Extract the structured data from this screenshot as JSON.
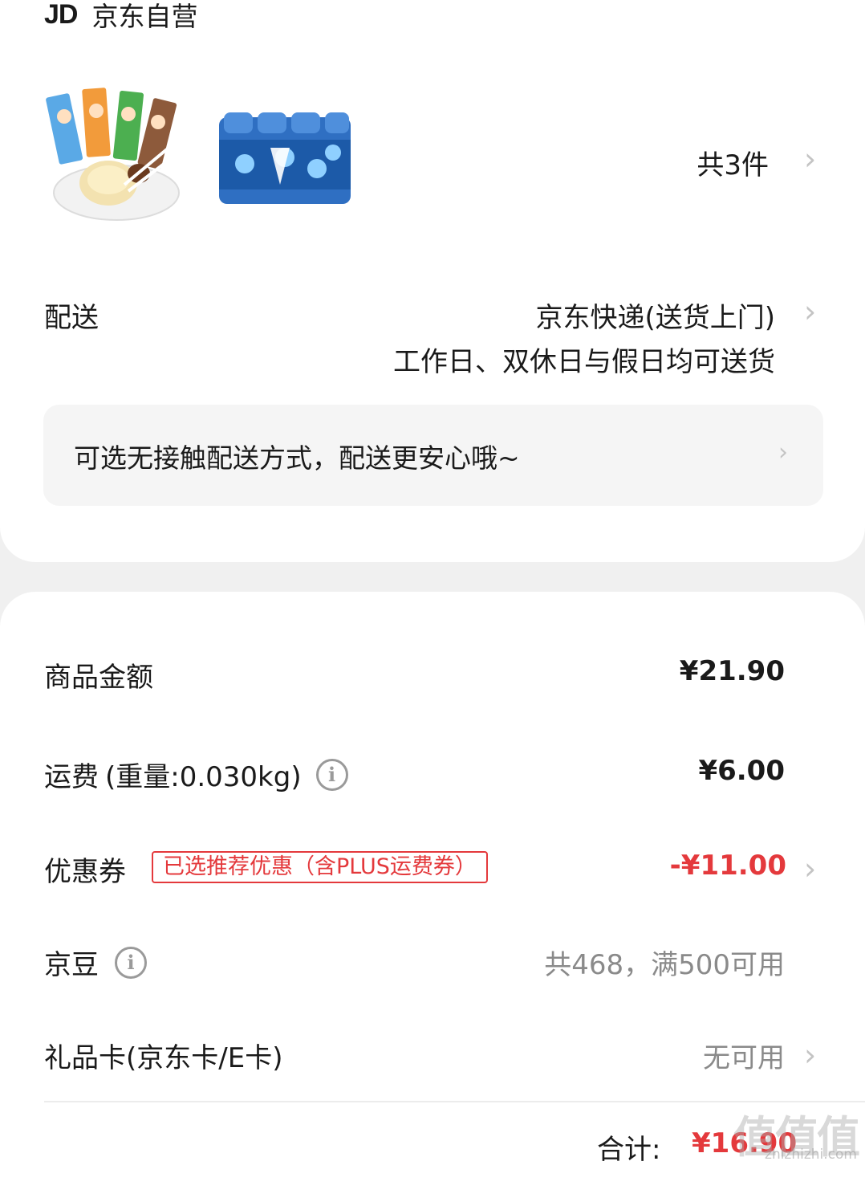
{
  "store": {
    "logo": "JD",
    "name": "京东自营"
  },
  "products": {
    "count_label": "共3件",
    "items": [
      {
        "icon": "candy-product-image"
      },
      {
        "icon": "water-bottles-product-image"
      }
    ]
  },
  "delivery": {
    "label": "配送",
    "method": "京东快递(送货上门)",
    "schedule": "工作日、双休日与假日均可送货",
    "notice": "可选无接触配送方式，配送更安心哦~"
  },
  "summary": {
    "goods_label": "商品金额",
    "goods_amount": "¥21.90",
    "shipping_label": "运费",
    "shipping_weight": "(重量:0.030kg)",
    "shipping_amount": "¥6.00",
    "coupon_label": "优惠券",
    "coupon_badge": "已选推荐优惠（含PLUS运费券）",
    "coupon_amount": "-¥11.00",
    "beans_label": "京豆",
    "beans_status": "共468，满500可用",
    "giftcard_label": "礼品卡(京东卡/E卡)",
    "giftcard_status": "无可用",
    "total_label": "合计:",
    "total_amount": "¥16.90"
  },
  "watermark": {
    "main": "值值值",
    "sub": "zhizhizhi.com"
  },
  "colors": {
    "accent_red": "#e4393c",
    "background": "#f0f0f0",
    "card": "#ffffff"
  }
}
